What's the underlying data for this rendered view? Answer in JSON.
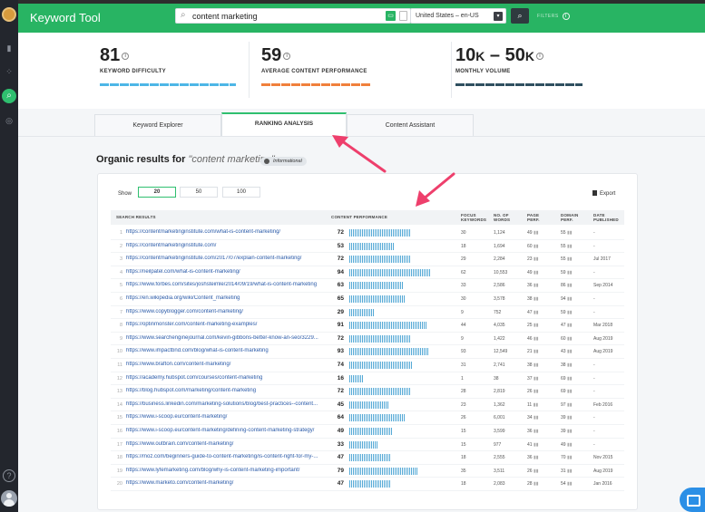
{
  "app": {
    "title": "Keyword Tool"
  },
  "search": {
    "query": "content marketing",
    "locale": "United States – en-US",
    "extra_label": "FILTERS"
  },
  "metrics": [
    {
      "value": "81",
      "label": "KEYWORD DIFFICULTY",
      "color": "#4db6e6"
    },
    {
      "value": "59",
      "label": "AVERAGE CONTENT PERFORMANCE",
      "color": "#f0803c"
    },
    {
      "value_main": "10",
      "unit1": "K",
      "dash": " – ",
      "value_main2": "50",
      "unit2": "K",
      "label": "MONTHLY VOLUME",
      "color": "#2f4f5f"
    }
  ],
  "tabs": [
    {
      "label": "Keyword Explorer"
    },
    {
      "label": "RANKING ANALYSIS",
      "active": true
    },
    {
      "label": "Content Assistant"
    }
  ],
  "organic": {
    "title": "Organic results for",
    "keyword": "\"content marketing\"",
    "badge": "Informational"
  },
  "controls": {
    "show_label": "Show",
    "page_sizes": [
      "20",
      "50",
      "100"
    ],
    "active_size": "20",
    "export_label": "Export"
  },
  "table": {
    "headers": {
      "search": "SEARCH RESULTS",
      "perf": "CONTENT PERFORMANCE",
      "focus1": "FOCUS",
      "focus2": "KEYWORDS",
      "words1": "NO. OF",
      "words2": "WORDS",
      "page1": "PAGE",
      "page2": "PERF.",
      "domain1": "DOMAIN",
      "domain2": "PERF.",
      "date1": "DATE",
      "date2": "PUBLISHED"
    },
    "rows": [
      {
        "n": "1",
        "url": "https://contentmarketinginstitute.com/what-is-content-marketing/",
        "score": "72",
        "focus": "30",
        "words": "1,124",
        "page": "49",
        "domain": "55",
        "date": "-"
      },
      {
        "n": "2",
        "url": "https://contentmarketinginstitute.com/",
        "score": "53",
        "focus": "18",
        "words": "1,694",
        "page": "60",
        "domain": "55",
        "date": "-"
      },
      {
        "n": "3",
        "url": "https://contentmarketinginstitute.com/2017/07/explain-content-marketing/",
        "score": "72",
        "focus": "29",
        "words": "2,284",
        "page": "23",
        "domain": "55",
        "date": "Jul 2017"
      },
      {
        "n": "4",
        "url": "https://neilpatel.com/what-is-content-marketing/",
        "score": "94",
        "focus": "62",
        "words": "10,553",
        "page": "49",
        "domain": "59",
        "date": "-"
      },
      {
        "n": "5",
        "url": "https://www.forbes.com/sites/joshsteimle/2014/09/19/what-is-content-marketing",
        "score": "63",
        "focus": "33",
        "words": "2,586",
        "page": "36",
        "domain": "86",
        "date": "Sep 2014"
      },
      {
        "n": "6",
        "url": "https://en.wikipedia.org/wiki/Content_marketing",
        "score": "65",
        "focus": "30",
        "words": "3,578",
        "page": "38",
        "domain": "94",
        "date": "-"
      },
      {
        "n": "7",
        "url": "https://www.copyblogger.com/content-marketing/",
        "score": "29",
        "focus": "9",
        "words": "752",
        "page": "47",
        "domain": "59",
        "date": "-"
      },
      {
        "n": "8",
        "url": "https://optinmonster.com/content-marketing-examples/",
        "score": "91",
        "focus": "44",
        "words": "4,035",
        "page": "25",
        "domain": "47",
        "date": "Mar 2018"
      },
      {
        "n": "9",
        "url": "https://www.searchenginejournal.com/kevin-gibbons-better-know-an-seo/3229...",
        "score": "72",
        "focus": "9",
        "words": "1,422",
        "page": "46",
        "domain": "60",
        "date": "Aug 2019"
      },
      {
        "n": "10",
        "url": "https://www.impactbnd.com/blog/what-is-content-marketing",
        "score": "93",
        "focus": "93",
        "words": "12,549",
        "page": "21",
        "domain": "43",
        "date": "Aug 2019"
      },
      {
        "n": "11",
        "url": "https://www.brafton.com/content-marketing/",
        "score": "74",
        "focus": "31",
        "words": "2,741",
        "page": "38",
        "domain": "38",
        "date": "-"
      },
      {
        "n": "12",
        "url": "https://academy.hubspot.com/courses/content-marketing",
        "score": "16",
        "focus": "1",
        "words": "38",
        "page": "37",
        "domain": "69",
        "date": "-"
      },
      {
        "n": "13",
        "url": "https://blog.hubspot.com/marketing/content-marketing",
        "score": "72",
        "focus": "28",
        "words": "2,819",
        "page": "26",
        "domain": "69",
        "date": "-"
      },
      {
        "n": "14",
        "url": "https://business.linkedin.com/marketing-solutions/blog/best-practices--content...",
        "score": "45",
        "focus": "23",
        "words": "1,362",
        "page": "11",
        "domain": "97",
        "date": "Feb 2016"
      },
      {
        "n": "15",
        "url": "https://www.i-scoop.eu/content-marketing/",
        "score": "64",
        "focus": "26",
        "words": "6,001",
        "page": "34",
        "domain": "39",
        "date": "-"
      },
      {
        "n": "16",
        "url": "https://www.i-scoop.eu/content-marketing/defining-content-marketing-strategy/",
        "score": "49",
        "focus": "15",
        "words": "3,599",
        "page": "36",
        "domain": "39",
        "date": "-"
      },
      {
        "n": "17",
        "url": "https://www.outbrain.com/content-marketing/",
        "score": "33",
        "focus": "15",
        "words": "977",
        "page": "41",
        "domain": "49",
        "date": "-"
      },
      {
        "n": "18",
        "url": "https://moz.com/beginners-guide-to-content-marketing/is-content-right-for-my-...",
        "score": "47",
        "focus": "18",
        "words": "2,555",
        "page": "36",
        "domain": "70",
        "date": "Nov 2015"
      },
      {
        "n": "19",
        "url": "https://www.lyfemarketing.com/blog/why-is-content-marketing-important/",
        "score": "79",
        "focus": "35",
        "words": "3,511",
        "page": "26",
        "domain": "31",
        "date": "Aug 2019"
      },
      {
        "n": "20",
        "url": "https://www.marketo.com/content-marketing/",
        "score": "47",
        "focus": "18",
        "words": "2,083",
        "page": "28",
        "domain": "54",
        "date": "Jan 2016"
      }
    ]
  },
  "colors": {
    "brand_green": "#28b463",
    "bar_blue": "#55a9d6",
    "arrow_pink": "#ee3f6c"
  }
}
